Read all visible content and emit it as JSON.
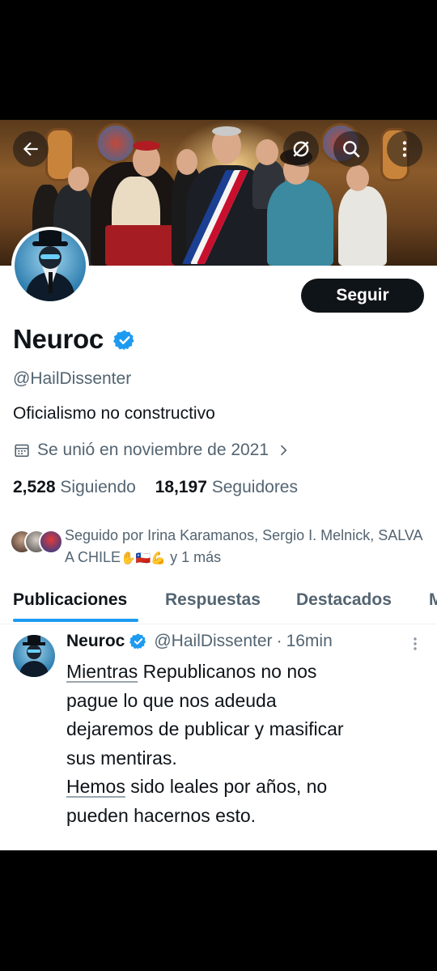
{
  "header": {
    "back_icon": "arrow-left-icon",
    "grok_icon": "grok-icon",
    "search_icon": "search-icon",
    "more_icon": "more-vertical-icon"
  },
  "profile": {
    "follow_label": "Seguir",
    "name": "Neuroc",
    "verified_icon": "verified-badge-icon",
    "handle": "@HailDissenter",
    "bio": "Oficialismo no constructivo",
    "joined": "Se unió en noviembre de 2021",
    "following_count": "2,528",
    "following_label": "Siguiendo",
    "followers_count": "18,197",
    "followers_label": "Seguidores",
    "followed_by": "Seguido por Irina Karamanos, Sergio I. Melnick, SALVA A CHILE",
    "followed_by_emojis": "✋🇨🇱💪",
    "followed_by_more": " y 1 más"
  },
  "tabs": [
    {
      "label": "Publicaciones",
      "active": true
    },
    {
      "label": "Respuestas",
      "active": false
    },
    {
      "label": "Destacados",
      "active": false
    },
    {
      "label": "M",
      "active": false
    }
  ],
  "post": {
    "author": "Neuroc",
    "handle": "@HailDissenter",
    "separator": "·",
    "time": "16min",
    "line1_link": "Mientras",
    "line1_rest": " Republicanos no nos",
    "line2": "pague lo que nos adeuda",
    "line3": "dejaremos de publicar y masificar",
    "line4": "sus mentiras.",
    "line5_link": "Hemos",
    "line5_rest": " sido leales por años, no",
    "line6": "pueden hacernos esto."
  },
  "colors": {
    "accent": "#1d9bf0",
    "text": "#0f1419",
    "secondary": "#536471",
    "button_bg": "#0f1419"
  }
}
